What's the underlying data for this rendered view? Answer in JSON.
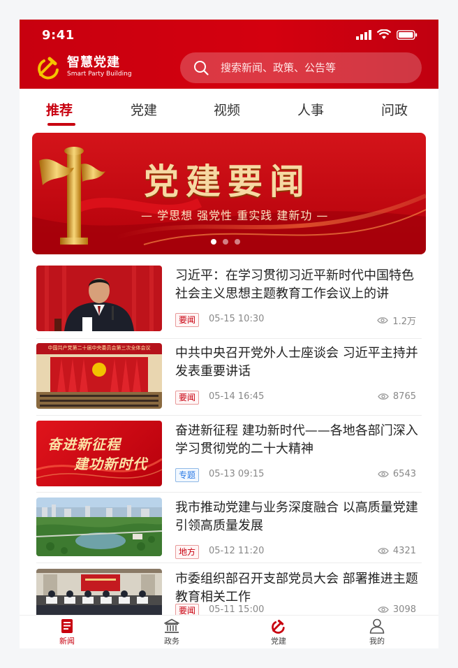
{
  "status": {
    "time": "9:41"
  },
  "brand": {
    "name_cn": "智慧党建",
    "name_en": "Smart Party Building"
  },
  "search": {
    "placeholder": "搜索新闻、政策、公告等"
  },
  "tabs": [
    {
      "label": "推荐",
      "active": true
    },
    {
      "label": "党建"
    },
    {
      "label": "视频"
    },
    {
      "label": "人事"
    },
    {
      "label": "问政"
    }
  ],
  "banner": {
    "title": "党建要闻",
    "subtitle": "— 学思想  强党性  重实践  建新功 —",
    "page_count": 3,
    "active_page": 1
  },
  "news": [
    {
      "title": "习近平：在学习贯彻习近平新时代中国特色社会主义思想主题教育工作会议上的讲",
      "tag": "要闻",
      "tag_color": "red",
      "date": "05-15  10:30",
      "views": "1.2万",
      "thumb": "leader-speech-image"
    },
    {
      "title": "中共中央召开党外人士座谈会 习近平主持并发表重要讲话",
      "tag": "要闻",
      "tag_color": "red",
      "date": "05-14  16:45",
      "views": "8765",
      "thumb": "plenary-session-image",
      "thumb_caption": "中国共产党第二十届中央委员会第三次全体会议"
    },
    {
      "title": "奋进新征程 建功新时代——各地各部门深入学习贯彻党的二十大精神",
      "tag": "专题",
      "tag_color": "blue",
      "date": "05-13  09:15",
      "views": "6543",
      "thumb": "slogan-image",
      "thumb_line1": "奋进新征程",
      "thumb_line2": "建功新时代"
    },
    {
      "title": "我市推动党建与业务深度融合 以高质量党建引领高质量发展",
      "tag": "地方",
      "tag_color": "red",
      "date": "05-12  11:20",
      "views": "4321",
      "thumb": "city-aerial-image"
    },
    {
      "title": "市委组织部召开支部党员大会 部署推进主题教育相关工作",
      "tag": "要闻",
      "tag_color": "red",
      "date": "05-11  15:00",
      "views": "3098",
      "thumb": "meeting-room-image"
    }
  ],
  "tabbar": [
    {
      "label": "新闻",
      "icon": "news-icon",
      "active": true
    },
    {
      "label": "政务",
      "icon": "government-building-icon"
    },
    {
      "label": "党建",
      "icon": "party-emblem-icon"
    },
    {
      "label": "我的",
      "icon": "profile-icon"
    }
  ],
  "colors": {
    "brand_red": "#c8000f",
    "gold": "#f6d9a3",
    "tag_blue": "#2c7be5"
  }
}
